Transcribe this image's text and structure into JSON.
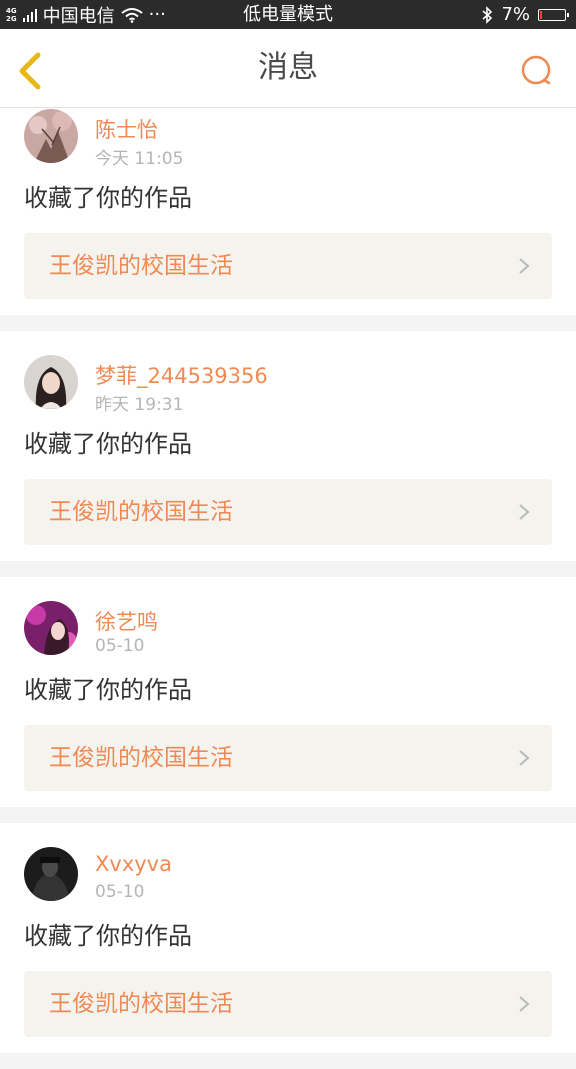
{
  "status_bar": {
    "network_type_top": "4G",
    "network_type_bottom": "2G",
    "carrier": "中国电信",
    "more": "···",
    "mode": "低电量模式",
    "battery_text": "7%",
    "battery_level": 0.07
  },
  "header": {
    "title": "消息"
  },
  "messages": [
    {
      "username": "陈士怡",
      "time": "今天 11:05",
      "action": "收藏了你的作品",
      "work_title": "王俊凯的校国生活"
    },
    {
      "username": "梦菲_244539356",
      "time": "昨天 19:31",
      "action": "收藏了你的作品",
      "work_title": "王俊凯的校国生活"
    },
    {
      "username": "徐艺鸣",
      "time": "05-10",
      "action": "收藏了你的作品",
      "work_title": "王俊凯的校国生活"
    },
    {
      "username": "Xvxyva",
      "time": "05-10",
      "action": "收藏了你的作品",
      "work_title": "王俊凯的校国生活"
    }
  ],
  "colors": {
    "accent": "#f08a55",
    "status_bar_bg": "#2b2b2b",
    "card_link_bg": "#f4f3ee",
    "back_icon": "#e8b81a"
  },
  "icons": {
    "back": "back-arrow-icon",
    "search": "search-icon",
    "chevron": "chevron-right-icon"
  }
}
